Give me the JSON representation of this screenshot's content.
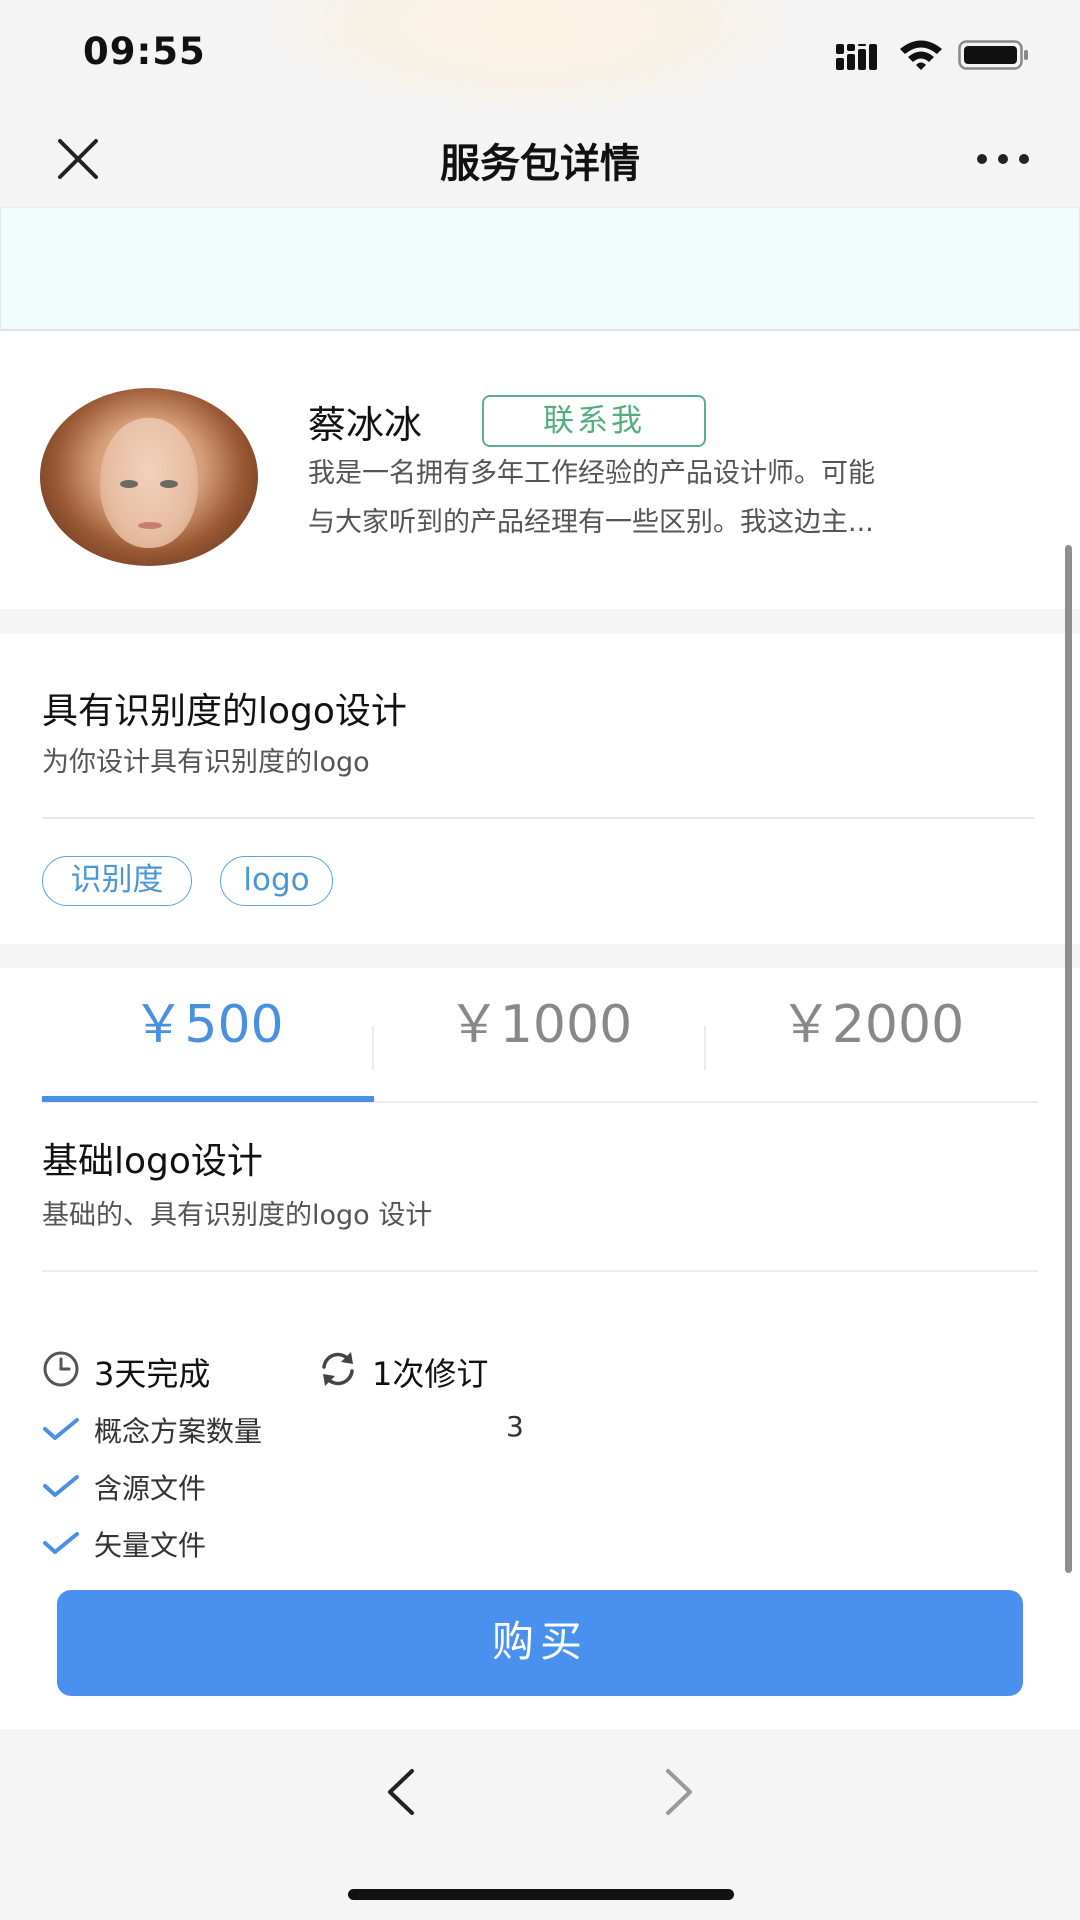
{
  "status_bar": {
    "time": "09:55"
  },
  "nav": {
    "title": "服务包详情"
  },
  "profile": {
    "name": "蔡冰冰",
    "contact_label": "联系我",
    "bio_line1": "我是一名拥有多年工作经验的产品设计师。可能",
    "bio_line2": "与大家听到的产品经理有一些区别。我这边主..."
  },
  "service": {
    "title": "具有识别度的logo设计",
    "subtitle": "为你设计具有识别度的logo",
    "tags": [
      "识别度",
      "logo"
    ]
  },
  "packages": {
    "tabs": [
      {
        "label": "￥500",
        "active": true
      },
      {
        "label": "￥1000",
        "active": false
      },
      {
        "label": "￥2000",
        "active": false
      }
    ],
    "selected": {
      "title": "基础logo设计",
      "description": "基础的、具有识别度的logo 设计",
      "duration": "3天完成",
      "revisions": "1次修订",
      "features": [
        {
          "label": "概念方案数量",
          "value": "3"
        },
        {
          "label": "含源文件",
          "value": ""
        },
        {
          "label": "矢量文件",
          "value": ""
        }
      ]
    },
    "buy_label": "购买"
  },
  "icons": {
    "close": "close-icon",
    "more": "more-icon",
    "clock": "clock-icon",
    "refresh": "refresh-icon",
    "check": "check-icon",
    "back": "back-icon",
    "forward": "forward-icon"
  },
  "colors": {
    "accent_blue": "#4a90e2",
    "contact_green": "#52ad83",
    "tag_blue": "#4a96d7",
    "buy_button": "#4a90ee"
  }
}
